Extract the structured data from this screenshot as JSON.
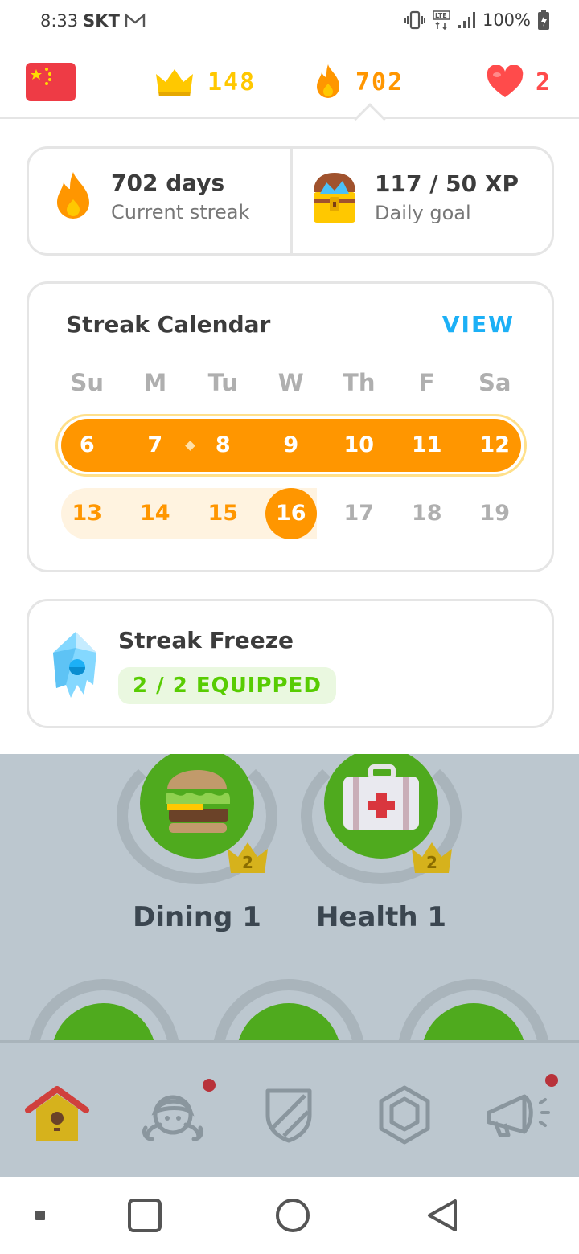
{
  "status_bar": {
    "time": "8:33",
    "carrier": "SKT",
    "mail_icon": "gmail-icon",
    "network": "LTE",
    "battery": "100%"
  },
  "top_stats": {
    "flag_icon": "china-flag-icon",
    "crowns": "148",
    "streak": "702",
    "hearts": "2",
    "colors": {
      "crown": "#ffc800",
      "streak": "#ff9600",
      "heart": "#ff4b4b"
    }
  },
  "summary": {
    "streak_title": "702 days",
    "streak_sub": "Current streak",
    "goal_title": "117 / 50 XP",
    "goal_sub": "Daily goal"
  },
  "calendar": {
    "title": "Streak Calendar",
    "view_label": "VIEW",
    "weekdays": [
      "Su",
      "M",
      "Tu",
      "W",
      "Th",
      "F",
      "Sa"
    ],
    "week1": [
      "6",
      "7",
      "8",
      "9",
      "10",
      "11",
      "12"
    ],
    "week2": [
      "13",
      "14",
      "15",
      "16",
      "17",
      "18",
      "19"
    ],
    "today": "16"
  },
  "freeze": {
    "title": "Streak Freeze",
    "badge": "2 / 2 EQUIPPED"
  },
  "skills": [
    {
      "label": "Dining 1",
      "level": "2",
      "icon": "burger-icon"
    },
    {
      "label": "Health 1",
      "level": "2",
      "icon": "first-aid-kit-icon"
    }
  ],
  "tabs": [
    {
      "name": "home",
      "icon": "birdhouse-icon",
      "active": true
    },
    {
      "name": "profile",
      "icon": "avatar-icon",
      "notification": true
    },
    {
      "name": "leagues",
      "icon": "shield-icon"
    },
    {
      "name": "shop",
      "icon": "gem-icon"
    },
    {
      "name": "news",
      "icon": "megaphone-icon",
      "notification": true
    }
  ]
}
